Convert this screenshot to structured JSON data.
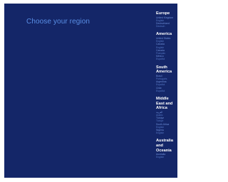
{
  "page": {
    "title": "Choose your region"
  },
  "regions": [
    {
      "name": "Europe",
      "entries": [
        {
          "country": "United Kingdom",
          "language": "English"
        },
        {
          "country": "Deutschland",
          "language": "Deutsch"
        }
      ]
    },
    {
      "name": "America",
      "entries": [
        {
          "country": "United States",
          "language": "English"
        },
        {
          "country": "Canada",
          "language": "English"
        },
        {
          "country": "Canada",
          "language": "Français"
        },
        {
          "country": "México",
          "language": "Español"
        }
      ]
    },
    {
      "name": "South America",
      "entries": [
        {
          "country": "Brasil",
          "language": "Português"
        },
        {
          "country": "Argentina",
          "language": "Español"
        },
        {
          "country": "Chile",
          "language": "Español"
        }
      ]
    },
    {
      "name": "Middle East and Africa",
      "entries": [
        {
          "country": "العربية",
          "language": "Arabic"
        },
        {
          "country": "Türkiye",
          "language": "Türkçe"
        },
        {
          "country": "South Africa",
          "language": "English"
        },
        {
          "country": "Nigeria",
          "language": "English"
        }
      ]
    },
    {
      "name": "Australia and Oceania",
      "entries": [
        {
          "country": "Australia",
          "language": "English"
        }
      ]
    }
  ]
}
